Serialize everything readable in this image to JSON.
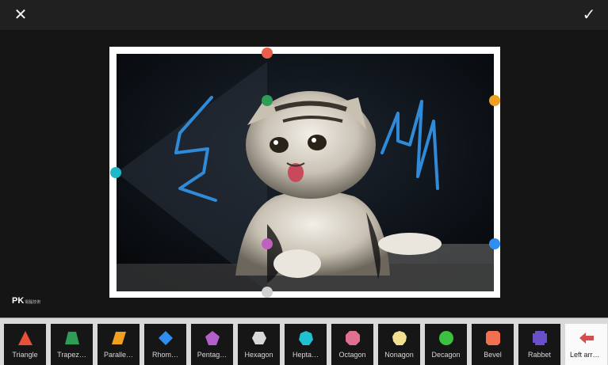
{
  "header": {
    "close_icon": "close-icon",
    "confirm_icon": "checkmark-icon"
  },
  "canvas": {
    "watermark": "PK",
    "watermark_sub": "電腦技術"
  },
  "handle_colors": {
    "top": "#e8604c",
    "inner_top": "#2e9e57",
    "right_top": "#f0a020",
    "left": "#1fb8c8",
    "inner_bottom": "#c060c0",
    "right_bottom": "#2f8ef0",
    "bottom": "#d0d0d0"
  },
  "shapes": [
    {
      "label": "Triangle",
      "icon": "triangle-icon",
      "color": "#e8503a"
    },
    {
      "label": "Trapez…",
      "icon": "trapezoid-icon",
      "color": "#2e9e57"
    },
    {
      "label": "Paralle…",
      "icon": "parallelogram-icon",
      "color": "#f0a020"
    },
    {
      "label": "Rhom…",
      "icon": "rhombus-icon",
      "color": "#2f8ef0"
    },
    {
      "label": "Pentag…",
      "icon": "pentagon-icon",
      "color": "#b060c8"
    },
    {
      "label": "Hexagon",
      "icon": "hexagon-icon",
      "color": "#d8d8d8"
    },
    {
      "label": "Hepta…",
      "icon": "heptagon-icon",
      "color": "#1fc0d0"
    },
    {
      "label": "Octagon",
      "icon": "octagon-icon",
      "color": "#e07090"
    },
    {
      "label": "Nonagon",
      "icon": "nonagon-icon",
      "color": "#f0e090"
    },
    {
      "label": "Decagon",
      "icon": "decagon-icon",
      "color": "#3cc040"
    },
    {
      "label": "Bevel",
      "icon": "bevel-icon",
      "color": "#f07050"
    },
    {
      "label": "Rabbet",
      "icon": "rabbet-icon",
      "color": "#6a50c8"
    },
    {
      "label": "Left arr…",
      "icon": "left-arrow-icon",
      "color": "#d05050"
    }
  ]
}
